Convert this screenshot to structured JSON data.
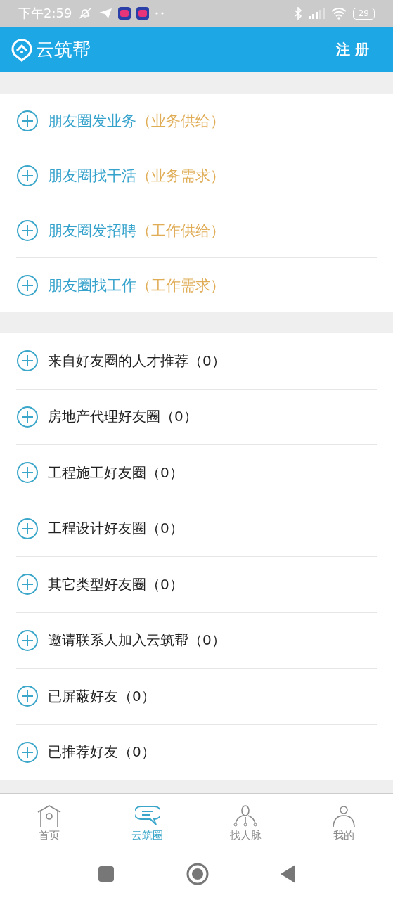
{
  "status_bar": {
    "time": "下午2:59",
    "battery": "29"
  },
  "header": {
    "logo": "云筑帮",
    "register": "注 册"
  },
  "post_items": [
    {
      "title": "朋友圈发业务",
      "note": "（业务供给）"
    },
    {
      "title": "朋友圈找干活",
      "note": "（业务需求）"
    },
    {
      "title": "朋友圈发招聘",
      "note": "（工作供给）"
    },
    {
      "title": "朋友圈找工作",
      "note": "（工作需求）"
    }
  ],
  "circle_items": [
    {
      "label": "来自好友圈的人才推荐（0）"
    },
    {
      "label": "房地产代理好友圈（0）"
    },
    {
      "label": "工程施工好友圈（0）"
    },
    {
      "label": "工程设计好友圈（0）"
    },
    {
      "label": "其它类型好友圈（0）"
    },
    {
      "label": "邀请联系人加入云筑帮（0）"
    },
    {
      "label": "已屏蔽好友（0）"
    },
    {
      "label": "已推荐好友（0）"
    }
  ],
  "tabs": [
    {
      "kind": "home",
      "label": "首页",
      "selected": false
    },
    {
      "kind": "chat",
      "label": "云筑圈",
      "selected": true
    },
    {
      "kind": "network",
      "label": "找人脉",
      "selected": false
    },
    {
      "kind": "me",
      "label": "我的",
      "selected": false
    }
  ]
}
